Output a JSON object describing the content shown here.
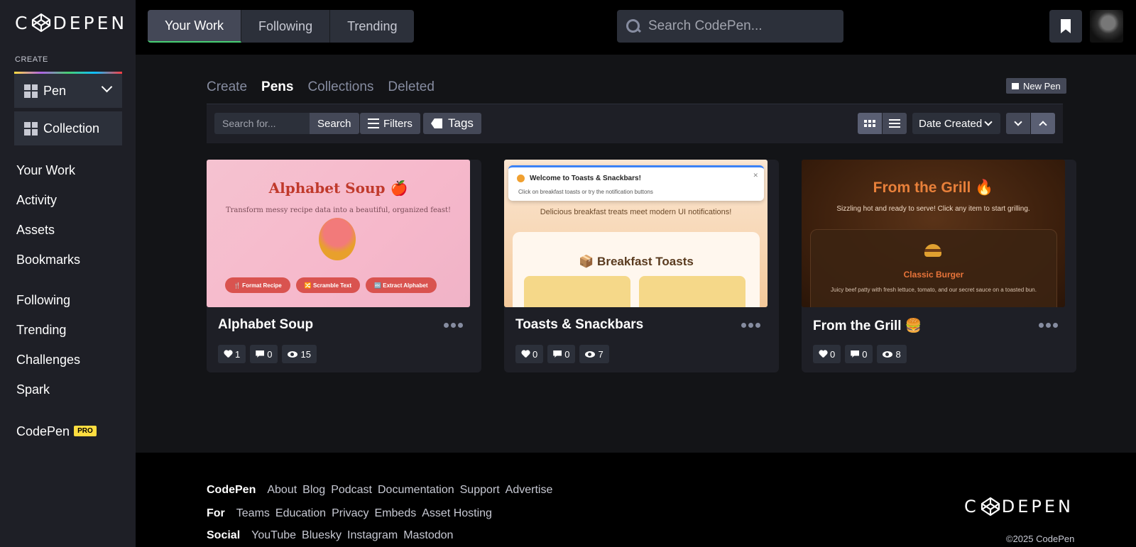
{
  "brand": {
    "logo_text_left": "C",
    "logo_text_right": "DEPEN"
  },
  "sidebar": {
    "create_label": "CREATE",
    "create_buttons": [
      {
        "label": "Pen",
        "icon": "grid-icon"
      },
      {
        "label": "Collection",
        "icon": "grid-icon"
      }
    ],
    "nav_primary": [
      "Your Work",
      "Activity",
      "Assets",
      "Bookmarks"
    ],
    "nav_secondary": [
      "Following",
      "Trending",
      "Challenges",
      "Spark"
    ],
    "pro": {
      "label": "CodePen",
      "badge": "PRO"
    }
  },
  "header": {
    "tabs": [
      "Your Work",
      "Following",
      "Trending"
    ],
    "active_tab": "Your Work",
    "search_placeholder": "Search CodePen..."
  },
  "main": {
    "subtabs": [
      "Create",
      "Pens",
      "Collections",
      "Deleted"
    ],
    "active_subtab": "Pens",
    "new_pen_label": "New Pen",
    "toolbar": {
      "search_placeholder": "Search for...",
      "search_button": "Search",
      "filters_button": "Filters",
      "tags_button": "Tags",
      "sort_label": "Date Created"
    },
    "cards": [
      {
        "title": "Alphabet Soup",
        "likes": "1",
        "comments": "0",
        "views": "15",
        "preview": {
          "title": "Alphabet Soup 🍎",
          "subtitle": "Transform messy recipe data into a beautiful, organized feast!",
          "buttons": [
            "🍴 Format Recipe",
            "🔀 Scramble Text",
            "🔤 Extract Alphabet"
          ]
        }
      },
      {
        "title": "Toasts & Snackbars",
        "likes": "0",
        "comments": "0",
        "views": "7",
        "preview": {
          "notif_title": "Welcome to Toasts & Snackbars!",
          "notif_desc": "Click on breakfast toasts or try the notification buttons",
          "tagline": "Delicious breakfast treats meet modern UI notifications!",
          "panel_title": "📦 Breakfast Toasts"
        }
      },
      {
        "title": "From the Grill 🍔",
        "likes": "0",
        "comments": "0",
        "views": "8",
        "preview": {
          "title": "From the Grill 🔥",
          "subtitle": "Sizzling hot and ready to serve! Click any item to start grilling.",
          "item_title": "Classic Burger",
          "item_desc": "Juicy beef patty with fresh lettuce, tomato, and our secret sauce on a toasted bun."
        }
      }
    ]
  },
  "footer": {
    "rows": [
      {
        "label": "CodePen",
        "links": [
          "About",
          "Blog",
          "Podcast",
          "Documentation",
          "Support",
          "Advertise"
        ]
      },
      {
        "label": "For",
        "links": [
          "Teams",
          "Education",
          "Privacy",
          "Embeds",
          "Asset Hosting"
        ]
      },
      {
        "label": "Social",
        "links": [
          "YouTube",
          "Bluesky",
          "Instagram",
          "Mastodon"
        ]
      }
    ],
    "copyright": "©2025 CodePen"
  },
  "colors": {
    "accent": "#47cf73",
    "pro_badge": "#ffdd40",
    "background": "#131417"
  }
}
